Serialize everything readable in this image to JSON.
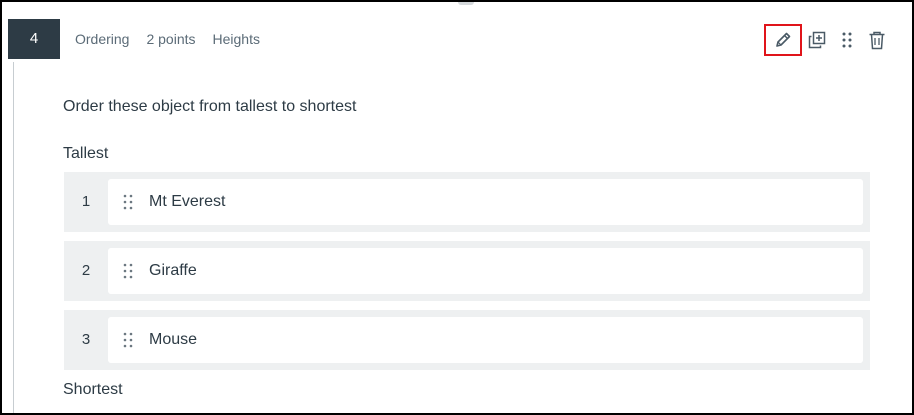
{
  "question": {
    "number": "4",
    "type": "Ordering",
    "points": "2 points",
    "title": "Heights",
    "prompt": "Order these object from tallest to shortest",
    "top_label": "Tallest",
    "bottom_label": "Shortest"
  },
  "toolbar": {
    "edit_icon": "pencil-icon",
    "copy_icon": "duplicate-icon",
    "move_icon": "drag-handle-icon",
    "delete_icon": "trash-icon"
  },
  "items": [
    {
      "position": "1",
      "label": "Mt Everest"
    },
    {
      "position": "2",
      "label": "Giraffe"
    },
    {
      "position": "3",
      "label": "Mouse"
    }
  ],
  "colors": {
    "number_badge": "#2d3b45",
    "highlight_box": "#e0141a",
    "row_background": "#eef0f1"
  }
}
